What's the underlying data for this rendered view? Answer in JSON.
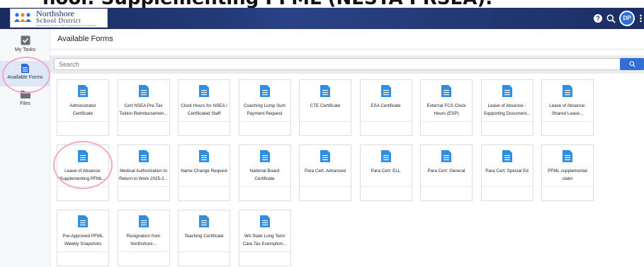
{
  "slide": {
    "title": "hool: Supplementing PFML (NESTA PRSEA)."
  },
  "app": {
    "logo": {
      "line1": "Northshore",
      "line2": "School District",
      "tagline": "Strengthening Our Community Through Excellence in Education"
    },
    "user_initials": "DP"
  },
  "sidebar": {
    "items": [
      {
        "label": "My Tasks"
      },
      {
        "label": "Available Forms"
      },
      {
        "label": "Files"
      }
    ]
  },
  "main": {
    "title": "Available Forms"
  },
  "search": {
    "placeholder": "Search"
  },
  "colors": {
    "accent": "#2f6fd6",
    "topbar": "#1f3470",
    "highlight_circle": "#f2a9c9"
  },
  "forms": [
    {
      "line1": "Administrator",
      "line2": "Certificate"
    },
    {
      "line1": "Cert NSEA Pre-Tax",
      "line2": "Tuition Reimbursemen..."
    },
    {
      "line1": "Clock Hours for NSEA /",
      "line2": "Certificated Staff"
    },
    {
      "line1": "Coaching Lump Sum",
      "line2": "Payment Request"
    },
    {
      "line1": "CTE Certificate",
      "line2": ""
    },
    {
      "line1": "ESA Certificate",
      "line2": ""
    },
    {
      "line1": "External FCS Clock",
      "line2": "Hours (ESP)"
    },
    {
      "line1": "Leave of Absence -",
      "line2": "Supporting Document..."
    },
    {
      "line1": "Leave of Absence:",
      "line2": "Shared Leave..."
    },
    {
      "line1": "Leave of Absence:",
      "line2": "Supplementing PFML..."
    },
    {
      "line1": "Medical Authorization to",
      "line2": "Return to Work 2025-2..."
    },
    {
      "line1": "Name Change Request",
      "line2": ""
    },
    {
      "line1": "National Board",
      "line2": "Certificate"
    },
    {
      "line1": "Para Cert: Advanced",
      "line2": ""
    },
    {
      "line1": "Para Cert: ELL",
      "line2": ""
    },
    {
      "line1": "Para Cert: General",
      "line2": ""
    },
    {
      "line1": "Para Cert: Special Ed",
      "line2": ""
    },
    {
      "line1": "PFML supplemental",
      "line2": "claim"
    },
    {
      "line1": "Pre-Approved PFML",
      "line2": "Weekly Snapshots"
    },
    {
      "line1": "Resignation from",
      "line2": "Northshore..."
    },
    {
      "line1": "Teaching Certificate",
      "line2": ""
    },
    {
      "line1": "WA State Long Term",
      "line2": "Care Tax Exemption..."
    }
  ]
}
